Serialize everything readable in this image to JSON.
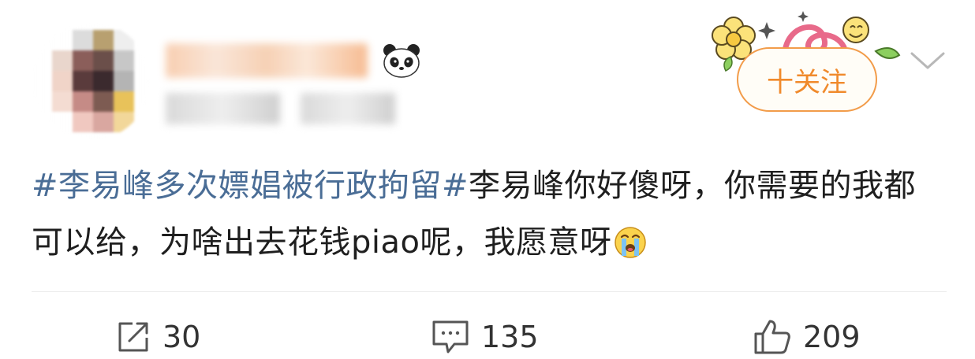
{
  "header": {
    "follow_label": "十关注"
  },
  "post": {
    "hashtag": "#李易峰多次嫖娼被行政拘留#",
    "text": "李易峰你好傻呀，你需要的我都可以给，为啥出去花钱piao呢，我愿意呀"
  },
  "actions": {
    "reposts": "30",
    "comments": "135",
    "likes": "209"
  },
  "colors": {
    "hashtag": "#4a6d96",
    "follow_border": "#f29c4a",
    "follow_text": "#f08a2c"
  },
  "icons": {
    "badge": "panda-icon",
    "menu": "chevron-down-icon",
    "repost": "share-icon",
    "comment": "comment-icon",
    "like": "thumbs-up-icon",
    "emoji": "crying-face-icon"
  }
}
